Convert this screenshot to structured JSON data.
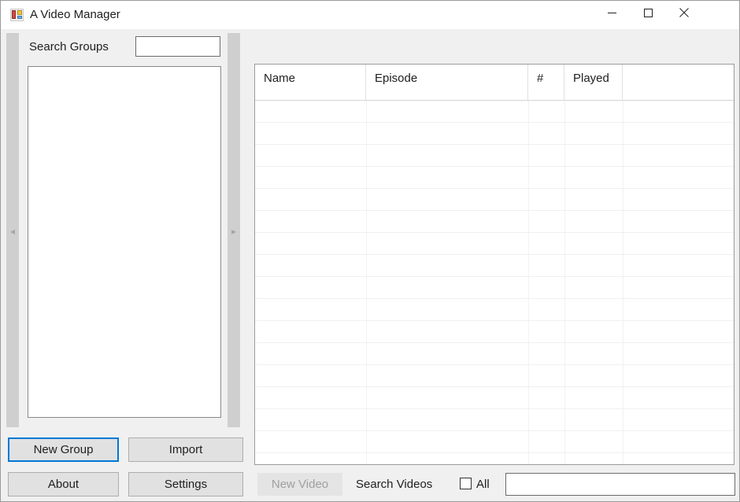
{
  "window": {
    "title": "A Video Manager",
    "icon": "app-icon",
    "controls": {
      "minimize": "minimize-icon",
      "maximize": "maximize-icon",
      "close": "close-icon"
    }
  },
  "left_panel": {
    "search_groups_label": "Search Groups",
    "search_groups_value": "",
    "search_groups_placeholder": "",
    "groups": [],
    "splitter_left_icon": "◂",
    "splitter_right_icon": "▸",
    "buttons": {
      "new_group": "New Group",
      "import": "Import",
      "about": "About",
      "settings": "Settings"
    },
    "focused_button": "New Group"
  },
  "grid": {
    "columns": [
      "Name",
      "Episode",
      "#",
      "Played",
      ""
    ],
    "rows": [],
    "empty_row_count": 17
  },
  "bottom_bar": {
    "new_video_label": "New Video",
    "new_video_enabled": false,
    "search_videos_label": "Search Videos",
    "all_label": "All",
    "all_checked": false,
    "search_videos_value": "",
    "search_videos_placeholder": ""
  },
  "colors": {
    "accent": "#0078d7",
    "window_background": "#f0f0f0",
    "control_background": "#e1e1e1",
    "splitter": "#cfcfcf",
    "text": "#202020",
    "disabled_text": "#a0a0a0"
  }
}
